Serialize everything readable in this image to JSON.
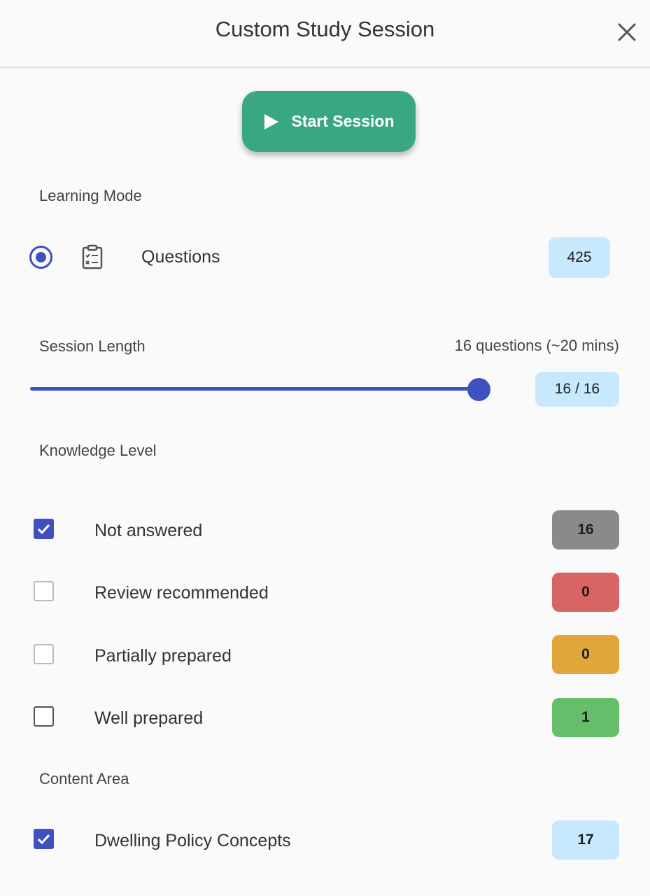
{
  "header": {
    "title": "Custom Study Session",
    "close_icon": "close-icon"
  },
  "start_button": {
    "label": "Start Session",
    "icon": "play-icon"
  },
  "learning_mode": {
    "label": "Learning Mode",
    "option": {
      "label": "Questions",
      "count": "425",
      "selected": true,
      "icon": "clipboard-checklist-icon"
    }
  },
  "session_length": {
    "label": "Session Length",
    "summary": "16 questions (~20 mins)",
    "counter": "16 / 16",
    "value": 16,
    "max": 16
  },
  "knowledge_level": {
    "label": "Knowledge Level",
    "items": [
      {
        "label": "Not answered",
        "count": "16",
        "checked": true,
        "color": "#8a8a8a"
      },
      {
        "label": "Review recommended",
        "count": "0",
        "checked": false,
        "color": "#d96464"
      },
      {
        "label": "Partially prepared",
        "count": "0",
        "checked": false,
        "color": "#e1a63a"
      },
      {
        "label": "Well prepared",
        "count": "1",
        "checked": false,
        "color": "#66bd6a"
      }
    ]
  },
  "content_area": {
    "label": "Content Area",
    "items": [
      {
        "label": "Dwelling Policy Concepts",
        "count": "17",
        "checked": true,
        "color": "#c8e8fd"
      }
    ]
  },
  "colors": {
    "accent": "#3f51c1",
    "start_button": "#3aa783",
    "badge_blue": "#c8e8fd"
  }
}
